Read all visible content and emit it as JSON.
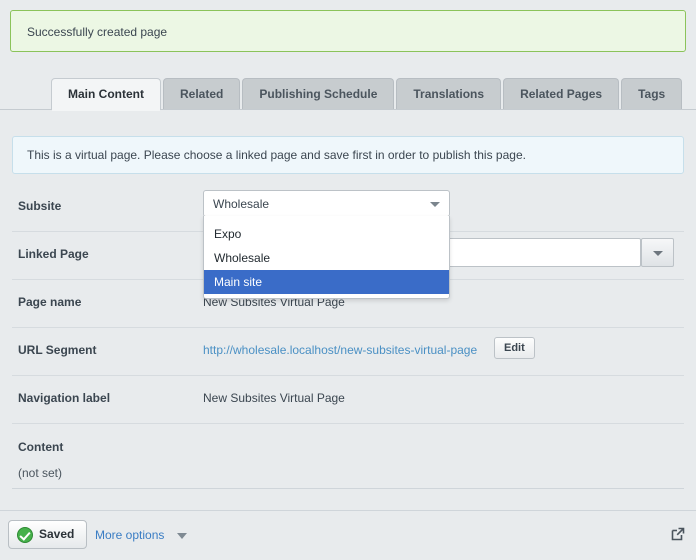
{
  "notification": {
    "message": "Successfully created page",
    "type": "success",
    "border_color": "#8bc35a",
    "background_color": "#ecf7e4"
  },
  "tabs": [
    {
      "label": "Main Content",
      "active": true
    },
    {
      "label": "Related",
      "active": false
    },
    {
      "label": "Publishing Schedule",
      "active": false
    },
    {
      "label": "Translations",
      "active": false
    },
    {
      "label": "Related Pages",
      "active": false
    },
    {
      "label": "Tags",
      "active": false
    }
  ],
  "info_box": {
    "message": "This is a virtual page. Please choose a linked page and save first in order to publish this page."
  },
  "form": {
    "subsite": {
      "label": "Subsite",
      "selected_value": "Wholesale",
      "dropdown_open": true,
      "options": [
        {
          "label": "Expo",
          "highlighted": false
        },
        {
          "label": "Wholesale",
          "highlighted": false
        },
        {
          "label": "Main site",
          "highlighted": true
        }
      ],
      "highlight_color": "#3a6cc8"
    },
    "linked_page": {
      "label": "Linked Page",
      "value": "",
      "placeholder": ""
    },
    "page_name": {
      "label": "Page name",
      "value": "New Subsites Virtual Page"
    },
    "url_segment": {
      "label": "URL Segment",
      "url": "http://wholesale.localhost/new-subsites-virtual-page",
      "edit_label": "Edit",
      "link_color": "#4a90c4"
    },
    "navigation_label": {
      "label": "Navigation label",
      "value": "New Subsites Virtual Page"
    },
    "content": {
      "label": "Content",
      "value": "(not set)"
    }
  },
  "bottom_bar": {
    "save_label": "Saved",
    "save_icon": "check-circle-icon",
    "more_options_label": "More options",
    "more_options_icon": "chevron-down-icon",
    "expand_icon": "external-link-icon"
  }
}
